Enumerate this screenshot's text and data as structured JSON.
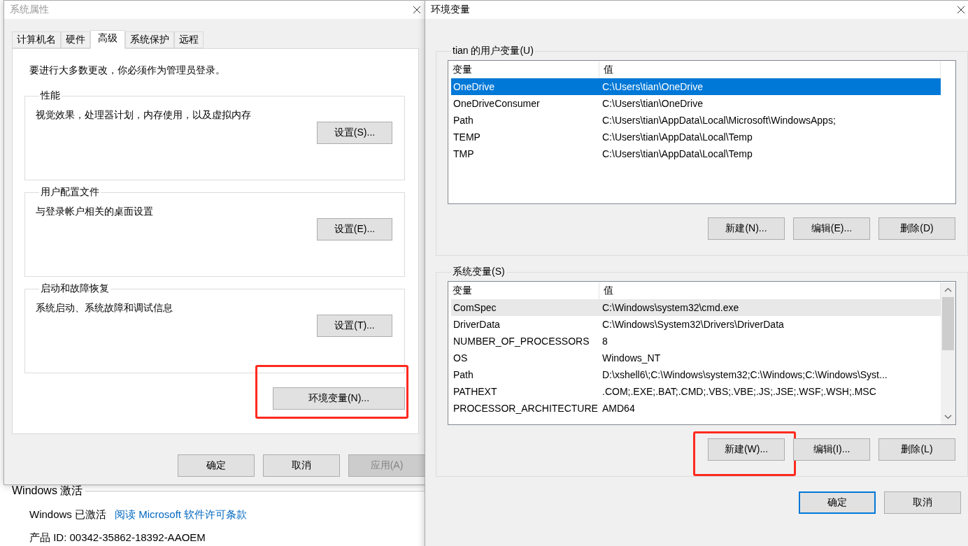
{
  "background": {
    "section_title": "Windows 激活",
    "status": "Windows 已激活",
    "license_link": "阅读 Microsoft 软件许可条款",
    "product_id": "产品 ID: 00342-35862-18392-AAOEM"
  },
  "system_properties": {
    "title": "系统属性",
    "active": false,
    "tabs": [
      {
        "label": "计算机名",
        "selected": false
      },
      {
        "label": "硬件",
        "selected": false
      },
      {
        "label": "高级",
        "selected": true
      },
      {
        "label": "系统保护",
        "selected": false
      },
      {
        "label": "远程",
        "selected": false
      }
    ],
    "notice": "要进行大多数更改，你必须作为管理员登录。",
    "groups": [
      {
        "title": "性能",
        "description": "视觉效果，处理器计划，内存使用，以及虚拟内存",
        "button": "设置(S)..."
      },
      {
        "title": "用户配置文件",
        "description": "与登录帐户相关的桌面设置",
        "button": "设置(E)..."
      },
      {
        "title": "启动和故障恢复",
        "description": "系统启动、系统故障和调试信息",
        "button": "设置(T)..."
      }
    ],
    "env_button": {
      "label": "环境变量(N)...",
      "highlighted": true
    },
    "buttons": [
      {
        "label": "确定",
        "disabled": false
      },
      {
        "label": "取消",
        "disabled": false
      },
      {
        "label": "应用(A)",
        "disabled": true
      }
    ]
  },
  "environment_variables": {
    "title": "环境变量",
    "active": true,
    "sections": [
      {
        "title": "tian 的用户变量(U)",
        "columns": [
          "变量",
          "值"
        ],
        "focused": true,
        "scrollbar": false,
        "rows": [
          {
            "name": "OneDrive",
            "value": "C:\\Users\\tian\\OneDrive",
            "selected": true
          },
          {
            "name": "OneDriveConsumer",
            "value": "C:\\Users\\tian\\OneDrive",
            "selected": false
          },
          {
            "name": "Path",
            "value": "C:\\Users\\tian\\AppData\\Local\\Microsoft\\WindowsApps;",
            "selected": false
          },
          {
            "name": "TEMP",
            "value": "C:\\Users\\tian\\AppData\\Local\\Temp",
            "selected": false
          },
          {
            "name": "TMP",
            "value": "C:\\Users\\tian\\AppData\\Local\\Temp",
            "selected": false
          }
        ],
        "buttons": [
          {
            "label": "新建(N)...",
            "highlighted": false
          },
          {
            "label": "编辑(E)...",
            "highlighted": false
          },
          {
            "label": "删除(D)",
            "highlighted": false
          }
        ]
      },
      {
        "title": "系统变量(S)",
        "columns": [
          "变量",
          "值"
        ],
        "focused": false,
        "scrollbar": true,
        "rows": [
          {
            "name": "ComSpec",
            "value": "C:\\Windows\\system32\\cmd.exe",
            "selected": true
          },
          {
            "name": "DriverData",
            "value": "C:\\Windows\\System32\\Drivers\\DriverData",
            "selected": false
          },
          {
            "name": "NUMBER_OF_PROCESSORS",
            "value": "8",
            "selected": false
          },
          {
            "name": "OS",
            "value": "Windows_NT",
            "selected": false
          },
          {
            "name": "Path",
            "value": "D:\\xshell6\\;C:\\Windows\\system32;C:\\Windows;C:\\Windows\\Syst...",
            "selected": false
          },
          {
            "name": "PATHEXT",
            "value": ".COM;.EXE;.BAT;.CMD;.VBS;.VBE;.JS;.JSE;.WSF;.WSH;.MSC",
            "selected": false
          },
          {
            "name": "PROCESSOR_ARCHITECTURE",
            "value": "AMD64",
            "selected": false
          }
        ],
        "buttons": [
          {
            "label": "新建(W)...",
            "highlighted": true
          },
          {
            "label": "编辑(I)...",
            "highlighted": false
          },
          {
            "label": "删除(L)",
            "highlighted": false
          }
        ]
      }
    ],
    "buttons": [
      {
        "label": "确定",
        "default": true
      },
      {
        "label": "取消",
        "default": false
      }
    ]
  }
}
